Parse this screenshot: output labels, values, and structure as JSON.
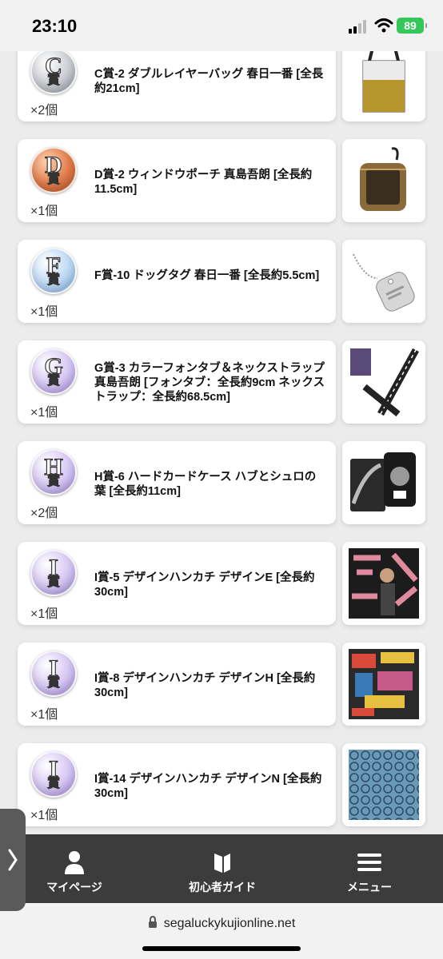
{
  "status_bar": {
    "time": "23:10",
    "battery": "89"
  },
  "prizes": [
    {
      "grade": "C",
      "kanji": "賞",
      "style": "silver",
      "title": "C賞-2 ダブルレイヤーバッグ 春日一番 [全長約21cm]",
      "count": "×2個",
      "art": "bag"
    },
    {
      "grade": "D",
      "kanji": "賞",
      "style": "bronze",
      "title": "D賞-2 ウィンドウポーチ 真島吾朗 [全長約11.5cm]",
      "count": "×1個",
      "art": "pouch"
    },
    {
      "grade": "F",
      "kanji": "賞",
      "style": "blue",
      "title": "F賞-10 ドッグタグ 春日一番 [全長約5.5cm]",
      "count": "×1個",
      "art": "dogtag"
    },
    {
      "grade": "G",
      "kanji": "賞",
      "style": "purple",
      "title": "G賞-3 カラーフォンタブ＆ネックストラップ 真島吾朗 [フォンタブ：全長約9cm ネックストラップ：全長約68.5cm]",
      "count": "×1個",
      "art": "strap"
    },
    {
      "grade": "H",
      "kanji": "賞",
      "style": "purple",
      "title": "H賞-6 ハードカードケース ハブとシュロの葉 [全長約11cm]",
      "count": "×2個",
      "art": "cardcase"
    },
    {
      "grade": "I",
      "kanji": "賞",
      "style": "purple",
      "title": "I賞-5 デザインハンカチ デザインE [全長約30cm]",
      "count": "×1個",
      "art": "hankie-e"
    },
    {
      "grade": "I",
      "kanji": "賞",
      "style": "purple",
      "title": "I賞-8 デザインハンカチ デザインH [全長約30cm]",
      "count": "×1個",
      "art": "hankie-h"
    },
    {
      "grade": "I",
      "kanji": "賞",
      "style": "purple",
      "title": "I賞-14 デザインハンカチ デザインN [全長約30cm]",
      "count": "×1個",
      "art": "hankie-n"
    }
  ],
  "nav": {
    "mypage": "マイページ",
    "guide": "初心者ガイド",
    "menu": "メニュー"
  },
  "url": "segaluckykujionline.net",
  "colors": {
    "nav_bg": "#3c3c3c",
    "battery": "#34c759"
  }
}
